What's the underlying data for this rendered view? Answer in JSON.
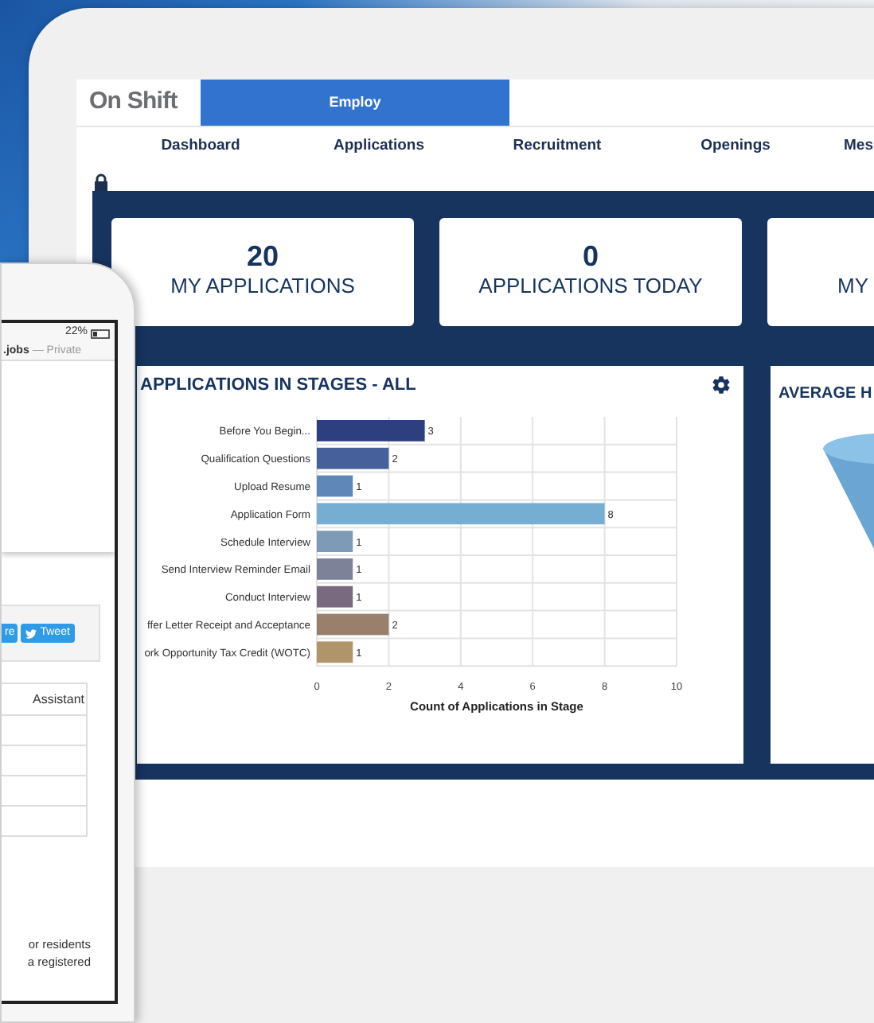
{
  "header": {
    "logo": "On Shift",
    "tab": "Employ"
  },
  "nav": [
    {
      "label": "Dashboard"
    },
    {
      "label": "Applications"
    },
    {
      "label": "Recruitment"
    },
    {
      "label": "Openings"
    },
    {
      "label": "Mes"
    }
  ],
  "stats": [
    {
      "value": "20",
      "label": "MY APPLICATIONS"
    },
    {
      "value": "0",
      "label": "APPLICATIONS TODAY"
    },
    {
      "label": "MY"
    }
  ],
  "stage_panel": {
    "title": "APPLICATIONS IN STAGES - ALL",
    "chart_data": {
      "type": "bar",
      "orientation": "horizontal",
      "xlabel": "Count of Applications in Stage",
      "categories": [
        "Before You Begin...",
        "Qualification Questions",
        "Upload Resume",
        "Application Form",
        "Schedule Interview",
        "Send Interview Reminder Email",
        "Conduct Interview",
        "ffer Letter Receipt and Acceptance",
        "ork Opportunity Tax Credit (WOTC)"
      ],
      "colors": [
        "#2e3f7f",
        "#45609a",
        "#5f87b8",
        "#76aed3",
        "#7d9bb6",
        "#7d8299",
        "#7a6a7f",
        "#9a806c",
        "#b0956a"
      ],
      "series": [
        {
          "values": [
            3,
            2,
            1,
            8,
            1,
            1,
            1,
            2,
            1
          ]
        }
      ],
      "grid": true,
      "xlim": [
        0,
        10
      ],
      "xticks": [
        0,
        2,
        4,
        6,
        8,
        10
      ],
      "data_labels": true
    }
  },
  "funnel_panel": {
    "title": "AVERAGE H"
  },
  "phone": {
    "battery": "22%",
    "url": ".jobs",
    "url_note": "— Private",
    "share_button": "re",
    "tweet_button": "Tweet",
    "table_rows": [
      "Assistant",
      "",
      "",
      "",
      ""
    ],
    "footer_lines": [
      "or residents",
      "a registered"
    ]
  }
}
